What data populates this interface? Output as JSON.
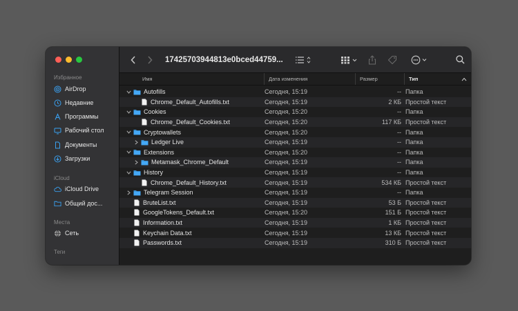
{
  "window": {
    "title": "17425703944813e0bced44759..."
  },
  "sidebar": {
    "sections": [
      {
        "label": "Избранное",
        "items": [
          {
            "label": "AirDrop",
            "icon": "airdrop-icon"
          },
          {
            "label": "Недавние",
            "icon": "clock-icon"
          },
          {
            "label": "Программы",
            "icon": "applications-icon"
          },
          {
            "label": "Рабочий стол",
            "icon": "desktop-icon"
          },
          {
            "label": "Документы",
            "icon": "document-icon"
          },
          {
            "label": "Загрузки",
            "icon": "downloads-icon"
          }
        ]
      },
      {
        "label": "iCloud",
        "items": [
          {
            "label": "iCloud Drive",
            "icon": "cloud-icon"
          },
          {
            "label": "Общий дос...",
            "icon": "shared-folder-icon"
          }
        ]
      },
      {
        "label": "Места",
        "items": [
          {
            "label": "Сеть",
            "icon": "network-icon"
          }
        ]
      },
      {
        "label": "Теги",
        "items": []
      }
    ]
  },
  "columns": {
    "name": "Имя",
    "date": "Дата изменения",
    "size": "Размер",
    "kind": "Тип"
  },
  "files": [
    {
      "name": "Autofills",
      "type": "folder",
      "level": 0,
      "expanded": true,
      "date": "Сегодня, 15:19",
      "size": "--",
      "kind": "Папка"
    },
    {
      "name": "Chrome_Default_Autofills.txt",
      "type": "file",
      "level": 1,
      "date": "Сегодня, 15:19",
      "size": "2 КБ",
      "kind": "Простой текст"
    },
    {
      "name": "Cookies",
      "type": "folder",
      "level": 0,
      "expanded": true,
      "date": "Сегодня, 15:20",
      "size": "--",
      "kind": "Папка"
    },
    {
      "name": "Chrome_Default_Cookies.txt",
      "type": "file",
      "level": 1,
      "date": "Сегодня, 15:20",
      "size": "117 КБ",
      "kind": "Простой текст"
    },
    {
      "name": "Cryptowallets",
      "type": "folder",
      "level": 0,
      "expanded": true,
      "date": "Сегодня, 15:20",
      "size": "--",
      "kind": "Папка"
    },
    {
      "name": "Ledger Live",
      "type": "folder",
      "level": 1,
      "expanded": false,
      "date": "Сегодня, 15:19",
      "size": "--",
      "kind": "Папка"
    },
    {
      "name": "Extensions",
      "type": "folder",
      "level": 0,
      "expanded": true,
      "date": "Сегодня, 15:20",
      "size": "--",
      "kind": "Папка"
    },
    {
      "name": "Metamask_Chrome_Default",
      "type": "folder",
      "level": 1,
      "expanded": false,
      "date": "Сегодня, 15:19",
      "size": "--",
      "kind": "Папка"
    },
    {
      "name": "History",
      "type": "folder",
      "level": 0,
      "expanded": true,
      "date": "Сегодня, 15:19",
      "size": "--",
      "kind": "Папка"
    },
    {
      "name": "Chrome_Default_History.txt",
      "type": "file",
      "level": 1,
      "date": "Сегодня, 15:19",
      "size": "534 КБ",
      "kind": "Простой текст"
    },
    {
      "name": "Telegram Session",
      "type": "folder",
      "level": 0,
      "expanded": false,
      "date": "Сегодня, 15:19",
      "size": "--",
      "kind": "Папка"
    },
    {
      "name": "BruteList.txt",
      "type": "file",
      "level": 0,
      "date": "Сегодня, 15:19",
      "size": "53 Б",
      "kind": "Простой текст"
    },
    {
      "name": "GoogleTokens_Default.txt",
      "type": "file",
      "level": 0,
      "date": "Сегодня, 15:20",
      "size": "151 Б",
      "kind": "Простой текст"
    },
    {
      "name": "Information.txt",
      "type": "file",
      "level": 0,
      "date": "Сегодня, 15:19",
      "size": "1 КБ",
      "kind": "Простой текст"
    },
    {
      "name": "Keychain Data.txt",
      "type": "file",
      "level": 0,
      "date": "Сегодня, 15:19",
      "size": "13 КБ",
      "kind": "Простой текст"
    },
    {
      "name": "Passwords.txt",
      "type": "file",
      "level": 0,
      "date": "Сегодня, 15:19",
      "size": "310 Б",
      "kind": "Простой текст"
    }
  ],
  "colors": {
    "accent": "#3aa0f0",
    "folder": "#45a8f5"
  }
}
